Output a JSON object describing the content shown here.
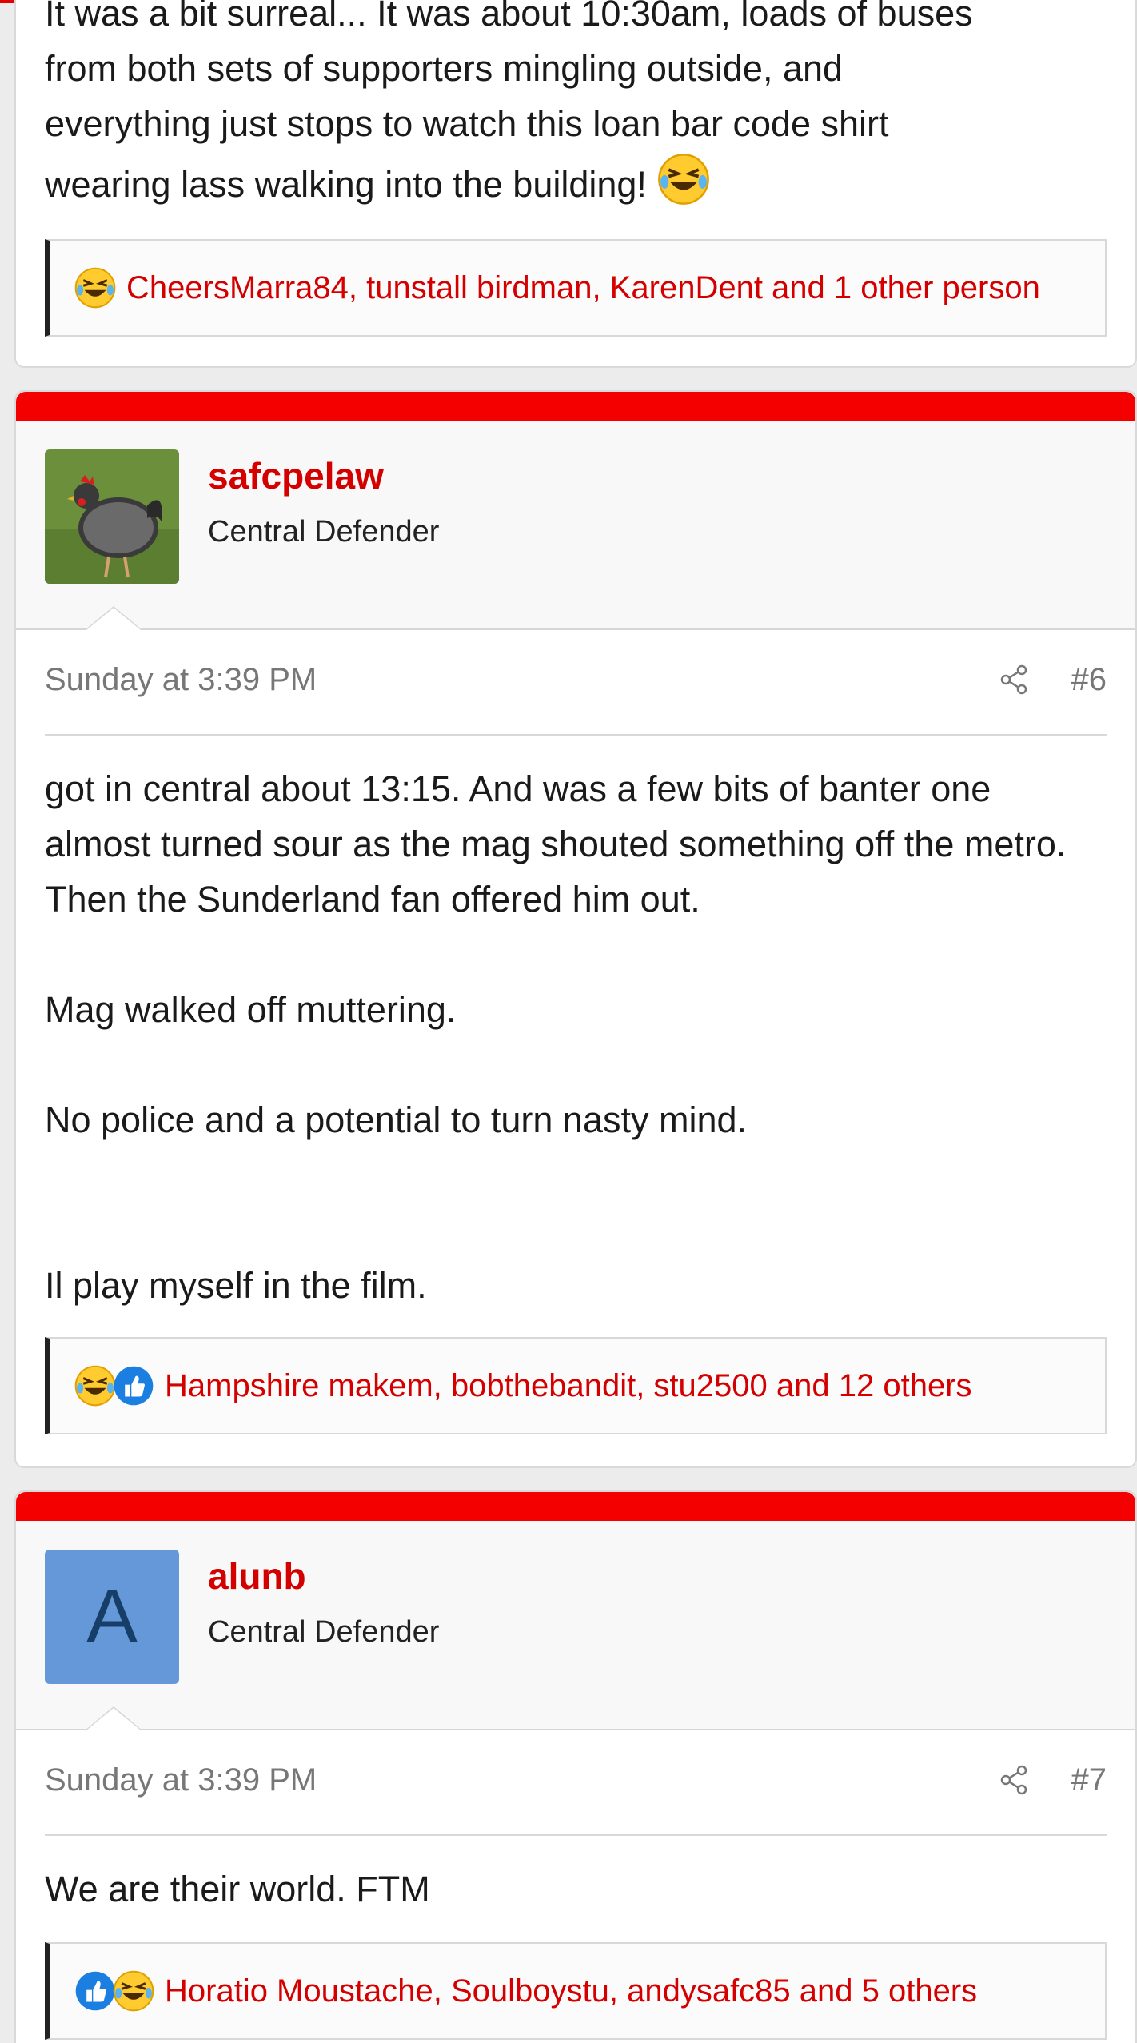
{
  "post5": {
    "body_lines": [
      "It was a bit surreal... It was about 10:30am, loads of buses",
      "from both sets of supporters mingling outside, and",
      "everything just stops to watch this loan bar code shirt",
      "wearing lass walking into the building!"
    ],
    "reactions": {
      "icons": [
        "laughing-emoji"
      ],
      "text": "CheersMarra84, tunstall birdman, KarenDent and 1 other person"
    }
  },
  "post6": {
    "username": "safcpelaw",
    "user_title": "Central Defender",
    "avatar": "chicken-photo",
    "date": "Sunday at 3:39 PM",
    "post_number": "#6",
    "paragraphs": [
      "got in central about 13:15. And was a few bits of banter one almost turned sour as the mag shouted something off the metro. Then the Sunderland fan offered him out.",
      "Mag walked off muttering.",
      "No police and a potential to turn nasty mind.",
      "Il play myself in the film."
    ],
    "reactions": {
      "icons": [
        "laughing-emoji",
        "thumbs-up-icon"
      ],
      "text": "Hampshire makem, bobthebandit, stu2500 and 12 others"
    }
  },
  "post7": {
    "username": "alunb",
    "user_title": "Central Defender",
    "avatar_letter": "A",
    "date": "Sunday at 3:39 PM",
    "post_number": "#7",
    "paragraphs": [
      "We are their world. FTM"
    ],
    "reactions": {
      "icons": [
        "thumbs-up-icon",
        "laughing-emoji"
      ],
      "text": "Horatio Moustache, Soulboystu, andysafc85 and 5 others"
    }
  },
  "colors": {
    "accent_red": "#f40000",
    "link_red": "#d40000",
    "avatar_blue": "#6498d8"
  }
}
